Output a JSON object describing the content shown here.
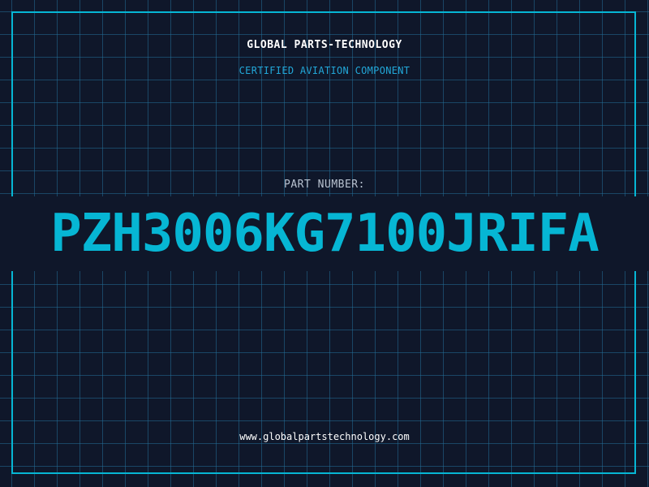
{
  "header": {
    "company_name": "GLOBAL PARTS-TECHNOLOGY",
    "subtitle": "CERTIFIED AVIATION COMPONENT"
  },
  "part": {
    "label": "PART NUMBER:",
    "number": "PZH3006KG7100JRIFA"
  },
  "footer": {
    "website": "www.globalpartstechnology.com"
  },
  "colors": {
    "background": "#0f172a",
    "accent": "#06b6d4",
    "grid": "#226e96",
    "label": "#b8c2d0"
  }
}
